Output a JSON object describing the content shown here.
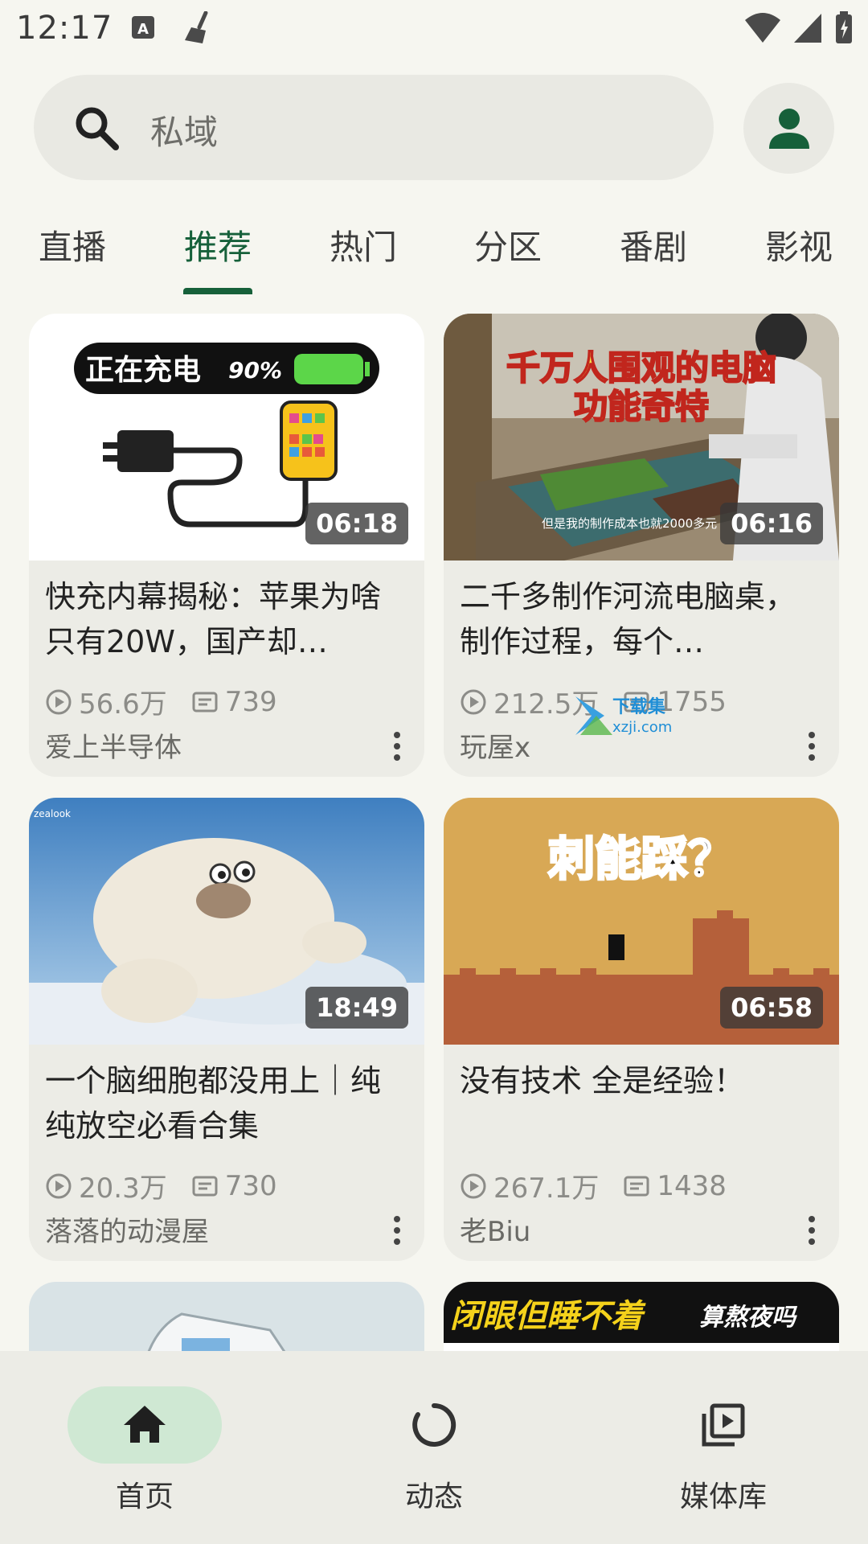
{
  "status_bar": {
    "time": "12:17"
  },
  "search": {
    "placeholder": "私域"
  },
  "tabs": [
    {
      "label": "直播"
    },
    {
      "label": "推荐"
    },
    {
      "label": "热门"
    },
    {
      "label": "分区"
    },
    {
      "label": "番剧"
    },
    {
      "label": "影视"
    }
  ],
  "active_tab": "推荐",
  "cards": [
    {
      "thumb_text": "正在充电",
      "thumb_percent": "90%",
      "duration": "06:18",
      "title": "快充内幕揭秘：苹果为啥只有20W，国产却…",
      "views": "56.6万",
      "comments": "739",
      "author": "爱上半导体"
    },
    {
      "thumb_text": "千万人围观的电脑",
      "thumb_text2": "功能奇特",
      "thumb_caption": "但是我的制作成本也就2000多元",
      "duration": "06:16",
      "title": "二千多制作河流电脑桌，制作过程，每个…",
      "views": "212.5万",
      "comments": "1755",
      "author": "玩屋x",
      "watermark": "下载集",
      "watermark2": "xzji.com"
    },
    {
      "thumb_caption": "zealook",
      "duration": "18:49",
      "title": "一个脑细胞都没用上｜纯纯放空必看合集",
      "views": "20.3万",
      "comments": "730",
      "author": "落落的动漫屋"
    },
    {
      "thumb_text": "刺能踩？",
      "duration": "06:58",
      "title": "没有技术 全是经验！",
      "views": "267.1万",
      "comments": "1438",
      "author": "老Biu"
    }
  ],
  "partial_cards": [
    {
      "thumb_text": "闭眼但睡不着",
      "thumb_text2": "算熬夜吗"
    }
  ],
  "bottom_nav": [
    {
      "label": "首页",
      "icon": "home-icon",
      "active": true
    },
    {
      "label": "动态",
      "icon": "dynamic-icon",
      "active": false
    },
    {
      "label": "媒体库",
      "icon": "library-icon",
      "active": false
    }
  ],
  "colors": {
    "accent": "#16603a",
    "active_pill": "#cfe8d3",
    "background": "#f6f6f0",
    "card": "#ecece6"
  }
}
